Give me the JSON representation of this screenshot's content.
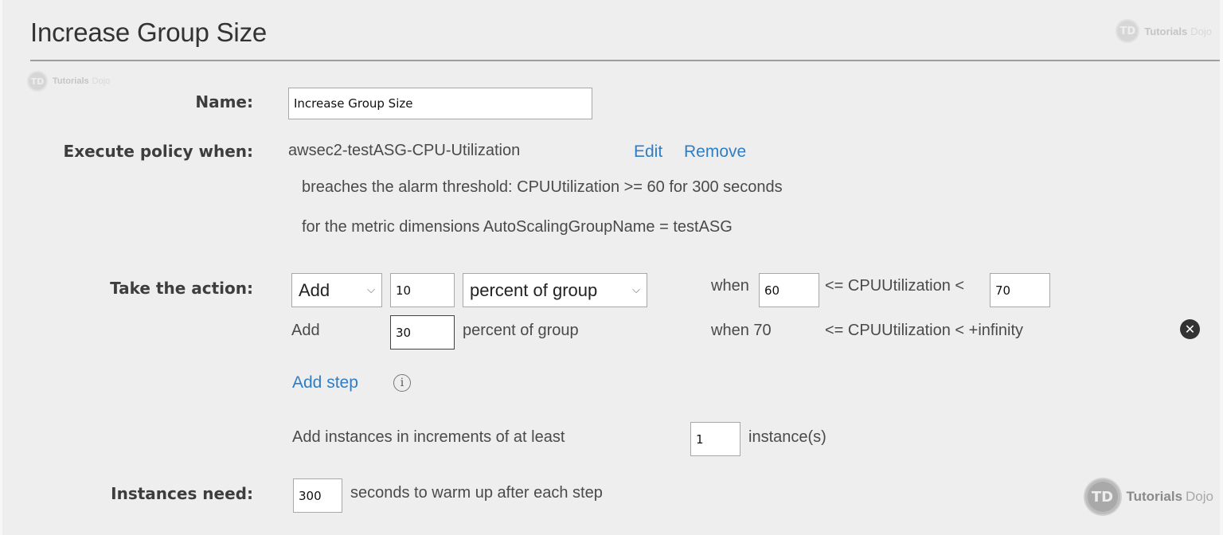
{
  "title": "Increase Group Size",
  "watermark": {
    "badge": "TD",
    "brand_a": "Tutorials",
    "brand_b": "Dojo"
  },
  "labels": {
    "name": "Name:",
    "execute": "Execute policy when:",
    "action": "Take the action:",
    "instances": "Instances need:"
  },
  "name_value": "Increase Group Size",
  "alarm": {
    "name": "awsec2-testASG-CPU-Utilization",
    "edit": "Edit",
    "remove": "Remove",
    "line1": "breaches the alarm threshold: CPUUtilization >= 60 for 300 seconds",
    "line2": "for the metric dimensions AutoScalingGroupName = testASG"
  },
  "steps": [
    {
      "operation": "Add",
      "value": "10",
      "unit": "percent of group",
      "when_label": "when",
      "lower": "60",
      "metric_text": "<= CPUUtilization <",
      "upper": "70"
    },
    {
      "operation": "Add",
      "value": "30",
      "unit": "percent of group",
      "when_label": "when 70",
      "metric_text": "<= CPUUtilization < +infinity"
    }
  ],
  "add_step": "Add step",
  "info_glyph": "i",
  "remove_glyph": "✕",
  "chevron_glyph": "⌵",
  "increments": {
    "prefix": "Add instances in increments of at least",
    "value": "1",
    "suffix": "instance(s)"
  },
  "warmup": {
    "value": "300",
    "suffix": "seconds to warm up after each step"
  }
}
